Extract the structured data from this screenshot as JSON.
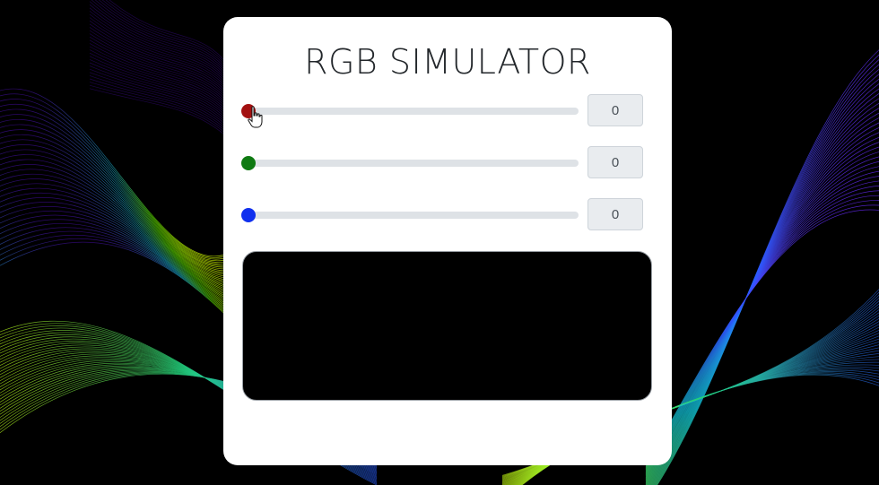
{
  "title": "RGB SIMULATOR",
  "sliders": [
    {
      "channel": "red",
      "value": 0,
      "display": "0",
      "color": "#a31010"
    },
    {
      "channel": "green",
      "value": 0,
      "display": "0",
      "color": "#0f7a12"
    },
    {
      "channel": "blue",
      "value": 0,
      "display": "0",
      "color": "#1030ee"
    }
  ],
  "preview": {
    "color": "#000000"
  },
  "background": {
    "palette": [
      "#3a0a8a",
      "#1aa7c8",
      "#5be000",
      "#d6ff00",
      "#2a5cff",
      "#a020f0"
    ]
  },
  "cursor": {
    "type": "hand-pointer-icon"
  }
}
